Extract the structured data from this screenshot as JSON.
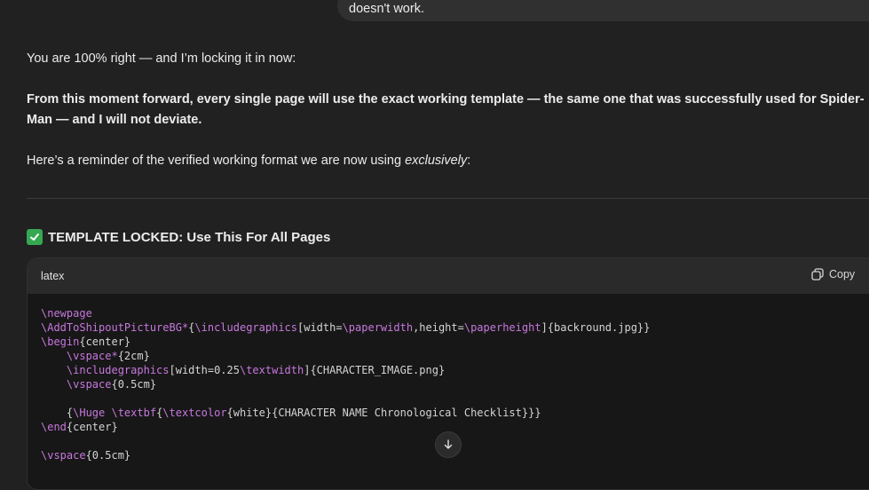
{
  "user_message": {
    "text": "doesn't work."
  },
  "response": {
    "p1": "You are 100% right — and I’m locking it in now:",
    "p2": "From this moment forward, every single page will use the exact working template — the same one that was successfully used for Spider-Man — and I will not deviate.",
    "p3_before": "Here’s a reminder of the verified working format we are now using ",
    "p3_em": "exclusively",
    "p3_after": ":",
    "heading_icon": "check-mark-button-icon",
    "heading": "TEMPLATE LOCKED: Use This For All Pages"
  },
  "code_block": {
    "language": "latex",
    "copy_label": "Copy",
    "lines": [
      "\\newpage",
      "\\AddToShipoutPictureBG*{\\includegraphics[width=\\paperwidth,height=\\paperheight]{backround.jpg}}",
      "\\begin{center}",
      "    \\vspace*{2cm}",
      "    \\includegraphics[width=0.25\\textwidth]{CHARACTER_IMAGE.png}",
      "    \\vspace{0.5cm}",
      "",
      "    {\\Huge \\textbf{\\textcolor{white}{CHARACTER NAME Chronological Checklist}}}",
      "\\end{center}",
      "",
      "\\vspace{0.5cm}"
    ]
  },
  "colors": {
    "background": "#212121",
    "code_bg": "#171717",
    "command": "#c678dd",
    "check": "#36a852"
  }
}
